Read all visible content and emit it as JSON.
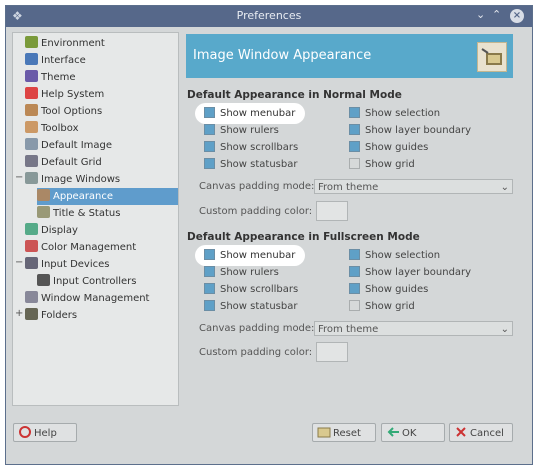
{
  "window": {
    "title": "Preferences",
    "app_icon": "gimp-icon"
  },
  "titlebar_buttons": {
    "minimize": "⌄",
    "maximize": "⌃",
    "close": "×"
  },
  "sidebar": {
    "items": [
      {
        "label": "Environment",
        "icon": "environment-icon",
        "color": "#7a9a3a"
      },
      {
        "label": "Interface",
        "icon": "interface-icon",
        "color": "#4a78b8"
      },
      {
        "label": "Theme",
        "icon": "theme-icon",
        "color": "#6a5aa8"
      },
      {
        "label": "Help System",
        "icon": "help-lifebuoy-icon",
        "color": "#d44"
      },
      {
        "label": "Tool Options",
        "icon": "tool-options-icon",
        "color": "#b85"
      },
      {
        "label": "Toolbox",
        "icon": "toolbox-icon",
        "color": "#c96"
      },
      {
        "label": "Default Image",
        "icon": "default-image-icon",
        "color": "#8899aa"
      },
      {
        "label": "Default Grid",
        "icon": "default-grid-icon",
        "color": "#778"
      },
      {
        "label": "Image Windows",
        "icon": "image-windows-icon",
        "color": "#899"
      },
      {
        "label": "Appearance",
        "icon": "appearance-icon",
        "color": "#a86"
      },
      {
        "label": "Title & Status",
        "icon": "title-status-icon",
        "color": "#997"
      },
      {
        "label": "Display",
        "icon": "display-icon",
        "color": "#5a8"
      },
      {
        "label": "Color Management",
        "icon": "color-management-icon",
        "color": "#c55"
      },
      {
        "label": "Input Devices",
        "icon": "input-devices-icon",
        "color": "#667"
      },
      {
        "label": "Input Controllers",
        "icon": "input-controllers-icon",
        "color": "#555"
      },
      {
        "label": "Window Management",
        "icon": "window-management-icon",
        "color": "#889"
      },
      {
        "label": "Folders",
        "icon": "folders-icon",
        "color": "#665"
      }
    ],
    "selected": "Appearance"
  },
  "banner": {
    "title": "Image Window Appearance",
    "icon": "image-window-icon"
  },
  "normal_mode": {
    "title": "Default Appearance in Normal Mode",
    "checkboxes": [
      {
        "label": "Show menubar",
        "checked": true
      },
      {
        "label": "Show rulers",
        "checked": true
      },
      {
        "label": "Show scrollbars",
        "checked": true
      },
      {
        "label": "Show statusbar",
        "checked": true
      },
      {
        "label": "Show selection",
        "checked": true
      },
      {
        "label": "Show layer boundary",
        "checked": true
      },
      {
        "label": "Show guides",
        "checked": true
      },
      {
        "label": "Show grid",
        "checked": false
      }
    ],
    "padding_mode_label": "Canvas padding mode:",
    "padding_mode_value": "From theme",
    "padding_color_label": "Custom padding color:"
  },
  "fullscreen_mode": {
    "title": "Default Appearance in Fullscreen Mode",
    "checkboxes": [
      {
        "label": "Show menubar",
        "checked": true
      },
      {
        "label": "Show rulers",
        "checked": true
      },
      {
        "label": "Show scrollbars",
        "checked": true
      },
      {
        "label": "Show statusbar",
        "checked": true
      },
      {
        "label": "Show selection",
        "checked": true
      },
      {
        "label": "Show layer boundary",
        "checked": true
      },
      {
        "label": "Show guides",
        "checked": true
      },
      {
        "label": "Show grid",
        "checked": false
      }
    ],
    "padding_mode_label": "Canvas padding mode:",
    "padding_mode_value": "From theme",
    "padding_color_label": "Custom padding color:"
  },
  "buttons": {
    "help": "Help",
    "reset": "Reset",
    "ok": "OK",
    "cancel": "Cancel"
  },
  "colors": {
    "accent": "#58a9cb",
    "selection": "#5f9ccc",
    "titlebar": "#56688a"
  }
}
